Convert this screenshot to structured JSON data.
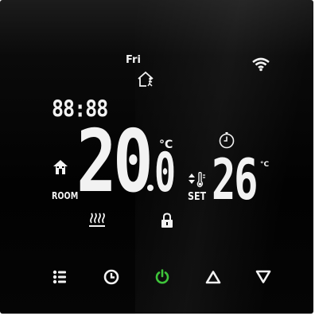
{
  "display": {
    "day": "Fri",
    "clock": "88:88",
    "room_temp_int": "20",
    "room_temp_dec": "0",
    "room_unit": "°C",
    "room_label": "ROOM",
    "set_temp": "26",
    "set_unit": "°C",
    "set_label": "SET"
  },
  "icons": {
    "wifi": "wifi-icon",
    "schedule_mode": "house-person-icon",
    "home": "home-icon",
    "heating": "heating-icon",
    "lock": "lock-icon",
    "timer": "timer-icon",
    "set_adjust": "updown-thermometer-icon"
  },
  "buttons": [
    {
      "name": "menu-button",
      "icon": "menu-icon"
    },
    {
      "name": "clock-button",
      "icon": "clock-icon"
    },
    {
      "name": "power-button",
      "icon": "power-icon"
    },
    {
      "name": "up-button",
      "icon": "triangle-up-icon"
    },
    {
      "name": "down-button",
      "icon": "triangle-down-icon"
    }
  ],
  "colors": {
    "background": "#030303",
    "segment": "#f2f2f2",
    "power_accent": "#3ec43a"
  }
}
